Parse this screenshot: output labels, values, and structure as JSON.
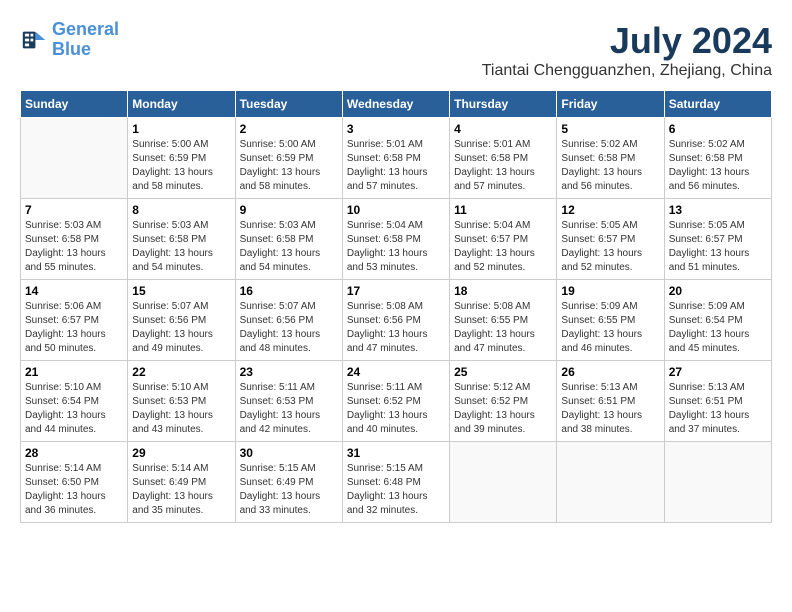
{
  "header": {
    "logo_general": "General",
    "logo_blue": "Blue",
    "month_title": "July 2024",
    "location": "Tiantai Chengguanzhen, Zhejiang, China"
  },
  "calendar": {
    "days_of_week": [
      "Sunday",
      "Monday",
      "Tuesday",
      "Wednesday",
      "Thursday",
      "Friday",
      "Saturday"
    ],
    "weeks": [
      [
        {
          "day": "",
          "info": ""
        },
        {
          "day": "1",
          "info": "Sunrise: 5:00 AM\nSunset: 6:59 PM\nDaylight: 13 hours\nand 58 minutes."
        },
        {
          "day": "2",
          "info": "Sunrise: 5:00 AM\nSunset: 6:59 PM\nDaylight: 13 hours\nand 58 minutes."
        },
        {
          "day": "3",
          "info": "Sunrise: 5:01 AM\nSunset: 6:58 PM\nDaylight: 13 hours\nand 57 minutes."
        },
        {
          "day": "4",
          "info": "Sunrise: 5:01 AM\nSunset: 6:58 PM\nDaylight: 13 hours\nand 57 minutes."
        },
        {
          "day": "5",
          "info": "Sunrise: 5:02 AM\nSunset: 6:58 PM\nDaylight: 13 hours\nand 56 minutes."
        },
        {
          "day": "6",
          "info": "Sunrise: 5:02 AM\nSunset: 6:58 PM\nDaylight: 13 hours\nand 56 minutes."
        }
      ],
      [
        {
          "day": "7",
          "info": ""
        },
        {
          "day": "8",
          "info": "Sunrise: 5:03 AM\nSunset: 6:58 PM\nDaylight: 13 hours\nand 54 minutes."
        },
        {
          "day": "9",
          "info": "Sunrise: 5:03 AM\nSunset: 6:58 PM\nDaylight: 13 hours\nand 54 minutes."
        },
        {
          "day": "10",
          "info": "Sunrise: 5:04 AM\nSunset: 6:58 PM\nDaylight: 13 hours\nand 53 minutes."
        },
        {
          "day": "11",
          "info": "Sunrise: 5:04 AM\nSunset: 6:57 PM\nDaylight: 13 hours\nand 52 minutes."
        },
        {
          "day": "12",
          "info": "Sunrise: 5:05 AM\nSunset: 6:57 PM\nDaylight: 13 hours\nand 52 minutes."
        },
        {
          "day": "13",
          "info": "Sunrise: 5:05 AM\nSunset: 6:57 PM\nDaylight: 13 hours\nand 51 minutes."
        }
      ],
      [
        {
          "day": "14",
          "info": ""
        },
        {
          "day": "15",
          "info": "Sunrise: 5:07 AM\nSunset: 6:56 PM\nDaylight: 13 hours\nand 49 minutes."
        },
        {
          "day": "16",
          "info": "Sunrise: 5:07 AM\nSunset: 6:56 PM\nDaylight: 13 hours\nand 48 minutes."
        },
        {
          "day": "17",
          "info": "Sunrise: 5:08 AM\nSunset: 6:56 PM\nDaylight: 13 hours\nand 47 minutes."
        },
        {
          "day": "18",
          "info": "Sunrise: 5:08 AM\nSunset: 6:55 PM\nDaylight: 13 hours\nand 47 minutes."
        },
        {
          "day": "19",
          "info": "Sunrise: 5:09 AM\nSunset: 6:55 PM\nDaylight: 13 hours\nand 46 minutes."
        },
        {
          "day": "20",
          "info": "Sunrise: 5:09 AM\nSunset: 6:54 PM\nDaylight: 13 hours\nand 45 minutes."
        }
      ],
      [
        {
          "day": "21",
          "info": ""
        },
        {
          "day": "22",
          "info": "Sunrise: 5:10 AM\nSunset: 6:53 PM\nDaylight: 13 hours\nand 43 minutes."
        },
        {
          "day": "23",
          "info": "Sunrise: 5:11 AM\nSunset: 6:53 PM\nDaylight: 13 hours\nand 42 minutes."
        },
        {
          "day": "24",
          "info": "Sunrise: 5:11 AM\nSunset: 6:52 PM\nDaylight: 13 hours\nand 40 minutes."
        },
        {
          "day": "25",
          "info": "Sunrise: 5:12 AM\nSunset: 6:52 PM\nDaylight: 13 hours\nand 39 minutes."
        },
        {
          "day": "26",
          "info": "Sunrise: 5:13 AM\nSunset: 6:51 PM\nDaylight: 13 hours\nand 38 minutes."
        },
        {
          "day": "27",
          "info": "Sunrise: 5:13 AM\nSunset: 6:51 PM\nDaylight: 13 hours\nand 37 minutes."
        }
      ],
      [
        {
          "day": "28",
          "info": "Sunrise: 5:14 AM\nSunset: 6:50 PM\nDaylight: 13 hours\nand 36 minutes."
        },
        {
          "day": "29",
          "info": "Sunrise: 5:14 AM\nSunset: 6:49 PM\nDaylight: 13 hours\nand 35 minutes."
        },
        {
          "day": "30",
          "info": "Sunrise: 5:15 AM\nSunset: 6:49 PM\nDaylight: 13 hours\nand 33 minutes."
        },
        {
          "day": "31",
          "info": "Sunrise: 5:15 AM\nSunset: 6:48 PM\nDaylight: 13 hours\nand 32 minutes."
        },
        {
          "day": "",
          "info": ""
        },
        {
          "day": "",
          "info": ""
        },
        {
          "day": "",
          "info": ""
        }
      ]
    ],
    "week1_sun_info": "Sunrise: 5:03 AM\nSunset: 6:58 PM\nDaylight: 13 hours\nand 55 minutes.",
    "week2_sun_info": "Sunrise: 5:06 AM\nSunset: 6:57 PM\nDaylight: 13 hours\nand 50 minutes.",
    "week3_sun_info": "Sunrise: 5:10 AM\nSunset: 6:54 PM\nDaylight: 13 hours\nand 44 minutes."
  }
}
